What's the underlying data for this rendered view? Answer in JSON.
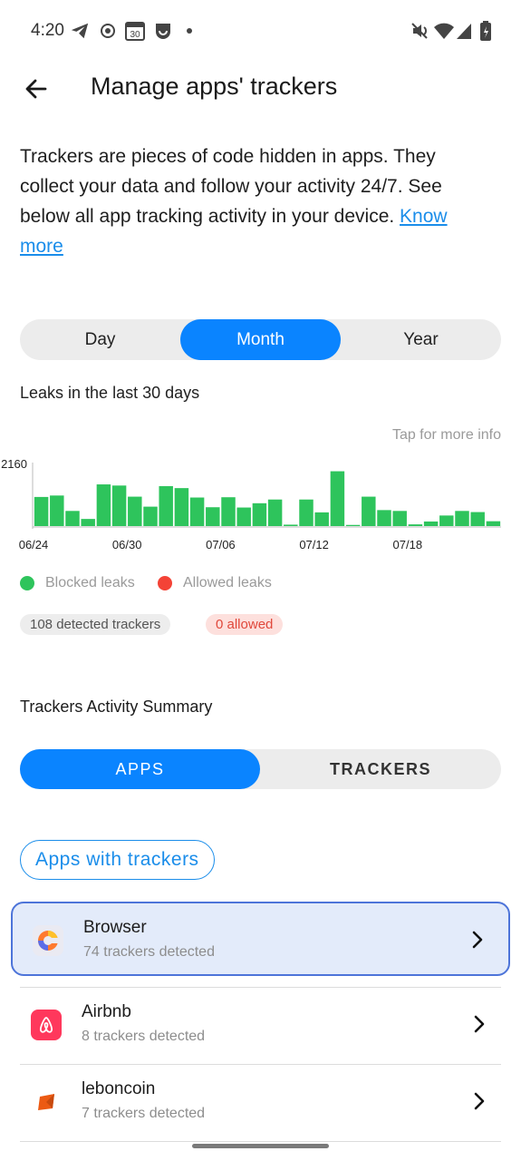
{
  "status_bar": {
    "time": "4:20",
    "icons": [
      "telegram-icon",
      "record-icon",
      "calendar-icon",
      "app-notification-icon",
      "dot-icon",
      "mute-icon",
      "wifi-icon",
      "signal-icon",
      "battery-icon"
    ],
    "calendar_day": "30"
  },
  "header": {
    "title": "Manage apps' trackers"
  },
  "intro": {
    "text": "Trackers are pieces of code hidden in apps. They collect your data and follow your activity 24/7. See below all app tracking activity in your device. ",
    "link": "Know more"
  },
  "range_tabs": {
    "items": [
      "Day",
      "Month",
      "Year"
    ],
    "selected": "Month"
  },
  "leaks_label": "Leaks in the last 30 days",
  "tap_info": "Tap for more info",
  "chart_data": {
    "type": "bar",
    "title": "",
    "x_tick_labels": [
      "06/24",
      "06/30",
      "07/06",
      "07/12",
      "07/18"
    ],
    "y_tick_labels": [
      "2160"
    ],
    "ylim": [
      0,
      2160
    ],
    "grid": false,
    "series": [
      {
        "name": "Blocked leaks",
        "color": "#2ec45c",
        "values": [
          1020,
          1070,
          530,
          250,
          1460,
          1420,
          1030,
          680,
          1400,
          1330,
          1000,
          660,
          1010,
          650,
          800,
          930,
          50,
          930,
          480,
          1920,
          40,
          1030,
          560,
          530,
          60,
          160,
          370,
          530,
          490,
          170
        ]
      },
      {
        "name": "Allowed leaks",
        "color": "#f44336",
        "values": [
          0,
          0,
          0,
          0,
          0,
          0,
          0,
          0,
          0,
          0,
          0,
          0,
          0,
          0,
          0,
          0,
          0,
          0,
          0,
          0,
          0,
          0,
          0,
          0,
          0,
          0,
          0,
          0,
          0,
          0
        ]
      }
    ]
  },
  "legend": {
    "blocked": {
      "label": "Blocked leaks",
      "color": "#2ec45c"
    },
    "allowed": {
      "label": "Allowed leaks",
      "color": "#f44336"
    }
  },
  "stats": {
    "detected": "108 detected trackers",
    "allowed": "0 allowed"
  },
  "summary_title": "Trackers Activity Summary",
  "summary_tabs": {
    "items": [
      "APPS",
      "TRACKERS"
    ],
    "selected": "APPS"
  },
  "filter_chip": "Apps with trackers",
  "apps": [
    {
      "name": "Browser",
      "detail": "74 trackers detected",
      "icon": "browser-icon",
      "selected": true
    },
    {
      "name": "Airbnb",
      "detail": "8 trackers detected",
      "icon": "airbnb-icon",
      "selected": false
    },
    {
      "name": "leboncoin",
      "detail": "7 trackers detected",
      "icon": "leboncoin-icon",
      "selected": false
    }
  ],
  "colors": {
    "accent": "#0a84ff",
    "link": "#1a8dea",
    "selected_row": "#e3ebfa",
    "selected_border": "#4d74d9"
  }
}
